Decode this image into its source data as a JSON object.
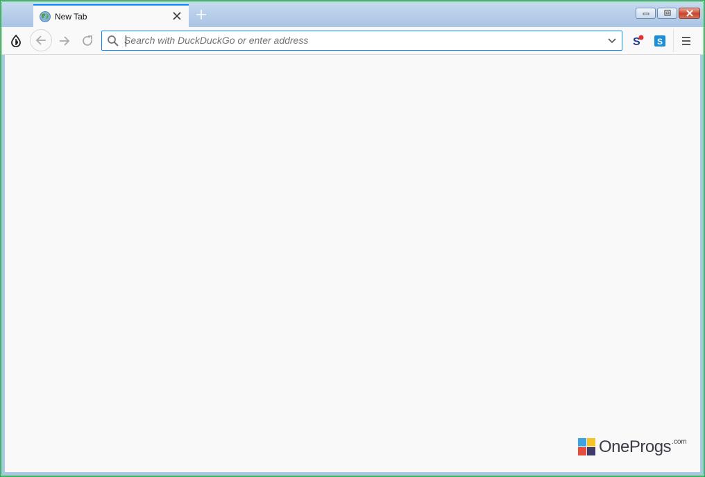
{
  "tabs": [
    {
      "title": "New Tab",
      "favicon": "globe-icon",
      "active": true
    }
  ],
  "toolbar": {
    "url_placeholder": "Search with DuckDuckGo or enter address",
    "url_value": ""
  },
  "extensions": [
    "extension-s-red-icon",
    "extension-s-blue-icon"
  ],
  "watermark": {
    "name": "OneProgs",
    "suffix": ".com"
  },
  "colors": {
    "accent": "#0a84ff",
    "frame": "#a9c6e4",
    "content": "#f9f9fa",
    "close_button": "#c8452f"
  }
}
